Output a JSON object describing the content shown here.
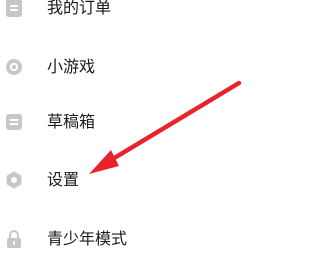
{
  "menu": {
    "items": [
      {
        "label": "我的订单",
        "icon": "document-list-icon"
      },
      {
        "label": "小游戏",
        "icon": "mini-game-icon"
      },
      {
        "label": "草稿箱",
        "icon": "drafts-box-icon"
      },
      {
        "label": "设置",
        "icon": "settings-gear-icon"
      },
      {
        "label": "青少年模式",
        "icon": "lock-icon"
      }
    ]
  },
  "colors": {
    "icon": "#c7c7c7",
    "text": "#1b1b1b",
    "arrow": "#e8232b",
    "background": "#ffffff"
  }
}
